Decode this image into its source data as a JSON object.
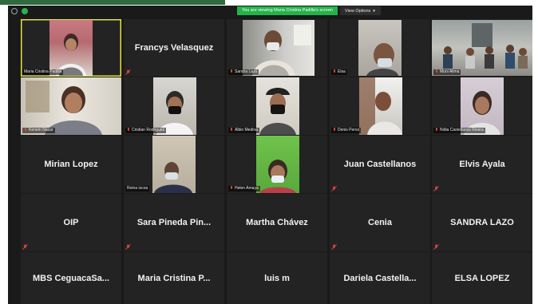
{
  "topbar": {
    "share_banner": "You are viewing Maria Cristina Padilla's screen",
    "view_options": "View Options"
  },
  "participants": {
    "maria_video": "Maria Cristina Padilla",
    "francys": "Francys Velasquez",
    "sandra_video": "Sandra Lazo",
    "elsa_video": "Elsa",
    "muni_video": "Muni Alima",
    "kenia_video": "Kenem Nazar",
    "cristian_video": "Cristian Rodriguez",
    "albin_video": "Albin Medina",
    "denis_video": "Denis Perez",
    "nidia_video": "Nidia Castellanos Rivera",
    "mirian": "Mirian Lopez",
    "reina_video": "Reina ixcoa",
    "helen_video": "Helen Amaya",
    "juan": "Juan Castellanos",
    "elvis": "Elvis Ayala",
    "oip": "OIP",
    "sara": "Sara Pineda Pin...",
    "martha": "Martha Chávez",
    "cenia": "Cenia",
    "sandra_lazo": "SANDRA LAZO",
    "mbs": "MBS CeguacaSa...",
    "maria_cp": "Maria Cristina P...",
    "luis": "luis m",
    "dariela": "Dariela Castella...",
    "elsa_lopez": "ELSA LOPEZ"
  },
  "colors": {
    "app_bg": "#1a1a1a",
    "tile_bg": "#232323",
    "speaker_border": "#e4e43a",
    "share_green": "#23b34a",
    "muted_red": "#e0463c"
  }
}
